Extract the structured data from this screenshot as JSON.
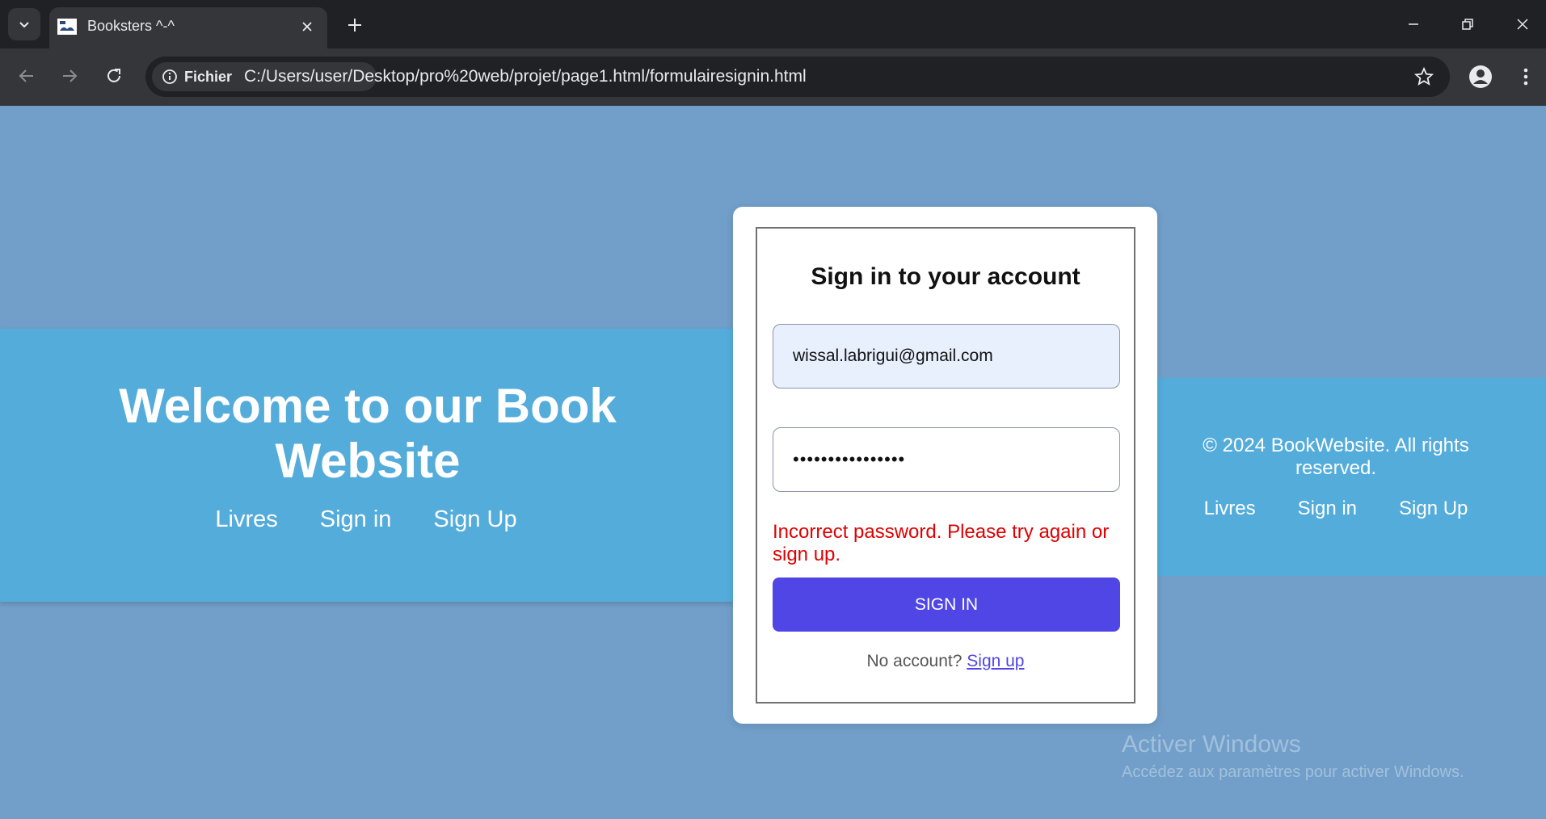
{
  "browser": {
    "tab_title": "Booksters ^-^",
    "site_chip": "Fichier",
    "url": "C:/Users/user/Desktop/pro%20web/projet/page1.html/formulairesignin.html"
  },
  "header": {
    "title": "Welcome to our Book Website",
    "nav": [
      "Livres",
      "Sign in",
      "Sign Up"
    ]
  },
  "form": {
    "title": "Sign in to your account",
    "email_value": "wissal.labrigui@gmail.com",
    "password_value": "••••••••••••••••",
    "error": "Incorrect password. Please try again or sign up.",
    "submit_label": "SIGN IN",
    "no_account_text": "No account?",
    "signup_link": "Sign up"
  },
  "footer": {
    "copyright": "© 2024 BookWebsite. All rights reserved.",
    "nav": [
      "Livres",
      "Sign in",
      "Sign Up"
    ]
  },
  "watermark": {
    "title": "Activer Windows",
    "subtitle": "Accédez aux paramètres pour activer Windows."
  },
  "colors": {
    "page_bg": "#719fc9",
    "band_bg": "#54acdb",
    "accent": "#4f46e5",
    "error": "#e00000"
  }
}
